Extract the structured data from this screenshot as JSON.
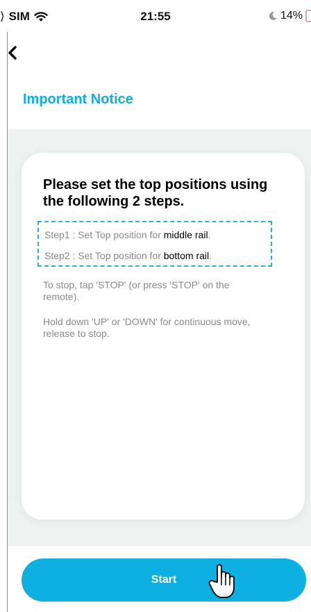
{
  "status_bar": {
    "carrier": "SIM",
    "time": "21:55",
    "battery": "14%",
    "icons": [
      "wifi-icon",
      "moon-icon",
      "battery-icon"
    ]
  },
  "header": {
    "back_icon": "chevron-left-icon",
    "title": "Important Notice"
  },
  "card": {
    "heading": "Please set the top positions using the following 2 steps.",
    "steps": [
      {
        "prefix": "Step1 : Set Top position for ",
        "highlight": "middle rail",
        "suffix": "."
      },
      {
        "prefix": "Step2 : Set Top position for ",
        "highlight": "bottom rail",
        "suffix": "."
      }
    ],
    "instructions": [
      "To stop, tap 'STOP' (or press 'STOP' on the remote).",
      "Hold down 'UP' or 'DOWN' for continuous move, release to stop."
    ]
  },
  "footer": {
    "start_label": "Start",
    "cursor_icon": "hand-pointer-icon"
  },
  "colors": {
    "accent": "#0eb0e1",
    "title": "#12aee0",
    "background": "#eef3f2",
    "muted_text": "#8a8a8a"
  }
}
